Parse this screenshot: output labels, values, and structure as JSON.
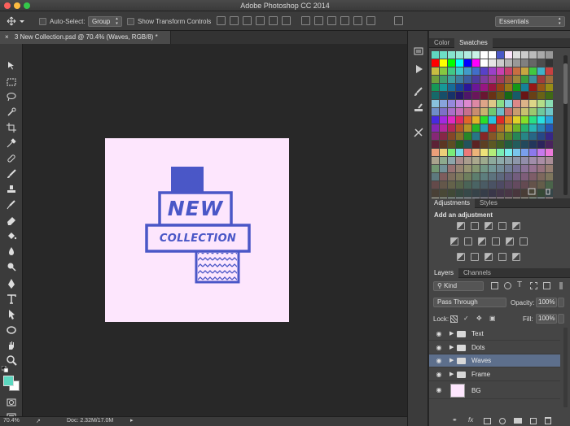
{
  "titlebar": {
    "title": "Adobe Photoshop CC 2014"
  },
  "options": {
    "auto_select_label": "Auto-Select:",
    "auto_select_value": "Group",
    "show_transform_label": "Show Transform Controls",
    "workspace": "Essentials"
  },
  "document": {
    "tab_label": "3 New Collection.psd @ 70.4% (Waves, RGB/8) *",
    "zoom": "70.4%",
    "doc_size": "Doc: 2.32M/17.0M"
  },
  "artwork": {
    "line1": "NEW",
    "line2": "COLLECTION",
    "primary_color": "#4a57c7",
    "background_color": "#fde6fd"
  },
  "tools": {
    "foreground_color": "#5cd8c0",
    "background_color": "#ffffff"
  },
  "swatches_panel": {
    "tabs": [
      "Color",
      "Swatches"
    ],
    "active_tab": "Swatches"
  },
  "adjustments_panel": {
    "tabs": [
      "Adjustments",
      "Styles"
    ],
    "active_tab": "Adjustments",
    "heading": "Add an adjustment"
  },
  "layers_panel": {
    "tabs": [
      "Layers",
      "Channels"
    ],
    "active_tab": "Layers",
    "filter": "Kind",
    "blend_mode": "Pass Through",
    "opacity_label": "Opacity:",
    "opacity_value": "100%",
    "lock_label": "Lock:",
    "fill_label": "Fill:",
    "fill_value": "100%",
    "layers": [
      {
        "name": "Text",
        "type": "group",
        "selected": false
      },
      {
        "name": "Dots",
        "type": "group",
        "selected": false
      },
      {
        "name": "Waves",
        "type": "group",
        "selected": true
      },
      {
        "name": "Frame",
        "type": "group",
        "selected": false
      },
      {
        "name": "BG",
        "type": "layer",
        "selected": false
      }
    ]
  }
}
